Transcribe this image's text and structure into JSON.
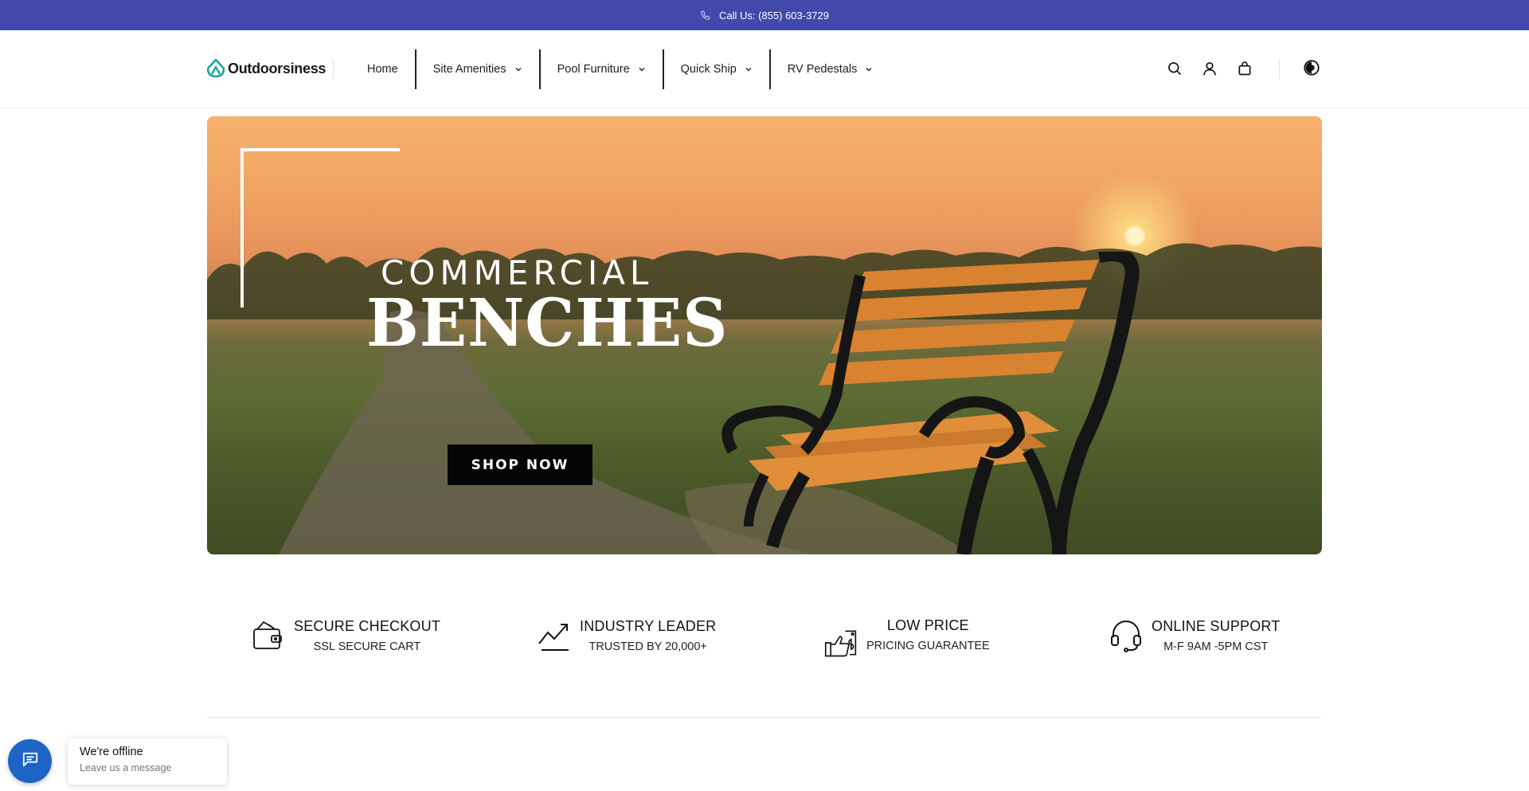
{
  "announcement": {
    "text": "Call Us: (855) 603-3729",
    "icon": "phone-icon"
  },
  "header": {
    "logo_text": "Outdoorsiness",
    "nav": [
      {
        "label": "Home",
        "has_dropdown": false
      },
      {
        "label": "Site Amenities",
        "has_dropdown": true
      },
      {
        "label": "Pool Furniture",
        "has_dropdown": true
      },
      {
        "label": "Quick Ship",
        "has_dropdown": true
      },
      {
        "label": "RV Pedestals",
        "has_dropdown": true
      }
    ],
    "icons": [
      "search-icon",
      "account-icon",
      "cart-icon",
      "contrast-icon"
    ]
  },
  "hero": {
    "line1": "COMMERCIAL",
    "line2": "BENCHES",
    "cta": "SHOP NOW"
  },
  "features": [
    {
      "title": "SECURE CHECKOUT",
      "subtitle": "SSL SECURE CART",
      "icon": "wallet-icon"
    },
    {
      "title": "INDUSTRY LEADER",
      "subtitle": "TRUSTED BY 20,000+",
      "icon": "trend-up-icon"
    },
    {
      "title": "LOW PRICE",
      "subtitle": "PRICING GUARANTEE",
      "icon": "price-tag-hand-icon"
    },
    {
      "title": "ONLINE SUPPORT",
      "subtitle": "M-F 9AM -5PM CST",
      "icon": "headset-icon"
    }
  ],
  "chat": {
    "title": "We're offline",
    "subtitle": "Leave us a message",
    "icon": "chat-icon"
  },
  "colors": {
    "announcement_bg": "#4349ab",
    "chat_button": "#1d64c7",
    "logo_accent": "#1aa69a"
  }
}
